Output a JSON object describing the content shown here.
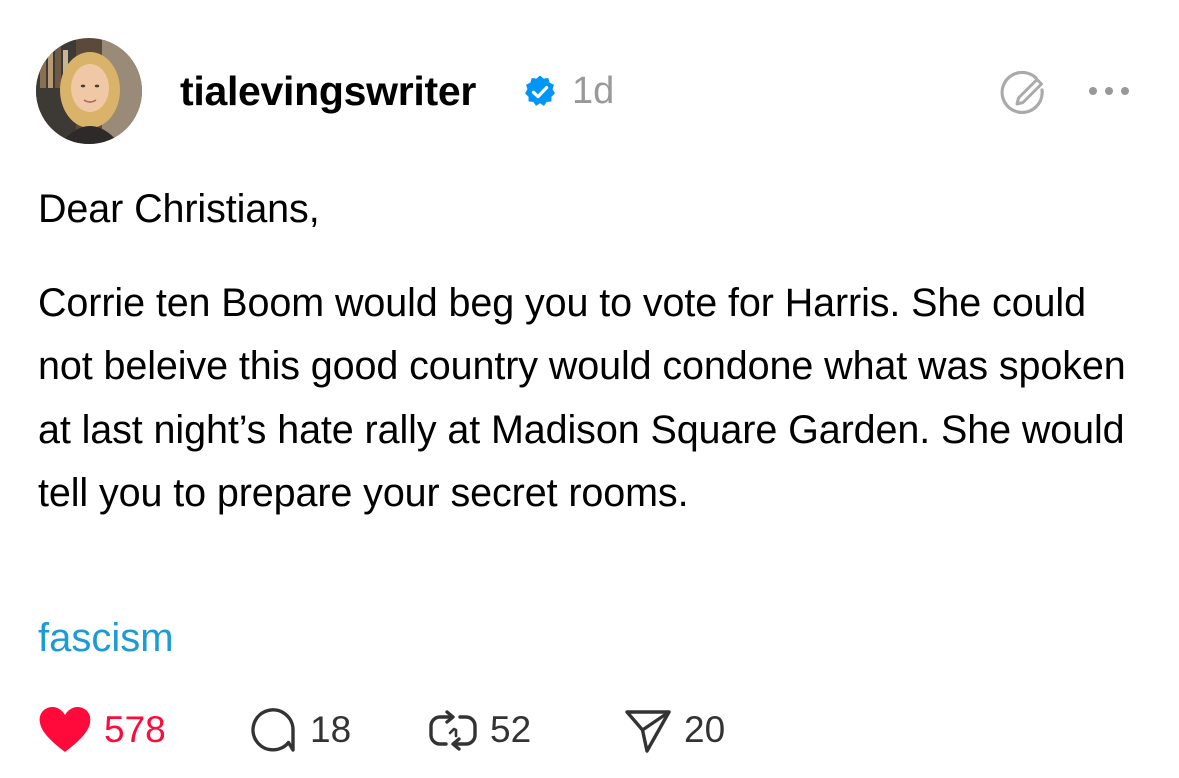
{
  "post": {
    "author": {
      "username": "tialevingswriter",
      "verified_icon": "verified-badge-icon",
      "avatar_icon": "profile-photo"
    },
    "time_ago": "1d",
    "header_icons": [
      "edit-icon",
      "more-options-icon"
    ],
    "greeting": "Dear Christians,",
    "body": "Corrie ten Boom would beg you to vote for Harris. She could not beleive this good country would condone what was spoken at last night’s hate rally at Madison Square Garden. She would tell you to prepare your secret rooms.",
    "tag": "fascism",
    "actions": {
      "likes": "578",
      "replies": "18",
      "reposts": "52",
      "shares": "20"
    }
  },
  "colors": {
    "like": "#ff0a3a",
    "tag": "#1d9bd7",
    "verified": "#0095f6",
    "muted": "#999999"
  }
}
